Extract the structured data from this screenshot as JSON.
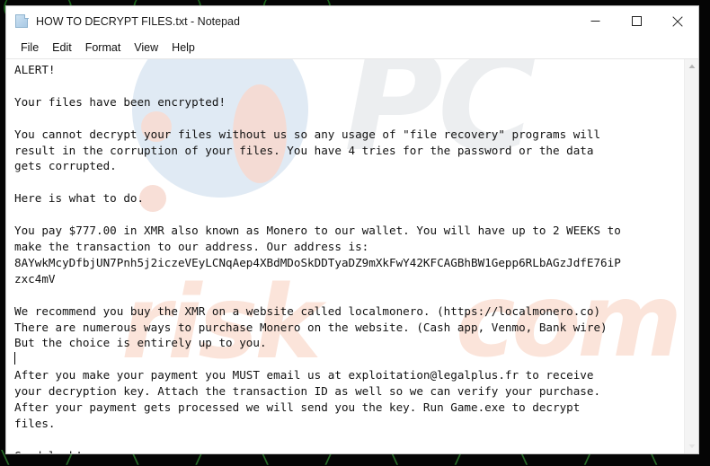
{
  "window": {
    "title": "HOW TO DECRYPT FILES.txt - Notepad",
    "app_icon": "notepad-document-icon",
    "controls": {
      "minimize": "minimize-icon",
      "maximize": "maximize-icon",
      "close": "close-icon"
    }
  },
  "menu": {
    "items": [
      {
        "label": "File"
      },
      {
        "label": "Edit"
      },
      {
        "label": "Format"
      },
      {
        "label": "View"
      },
      {
        "label": "Help"
      }
    ]
  },
  "scrollbar": {
    "up_arrow": "scroll-up-arrow-icon",
    "down_arrow": "scroll-down-arrow-icon"
  },
  "watermark": {
    "brand_mark": "PC",
    "word_left": "risk",
    "word_right": "com",
    "colors": {
      "blue_circle": "#dbe6f2",
      "peach_blob": "#f7dcd3",
      "grey_mark": "#eceef0",
      "peach_text": "#fbe4da"
    }
  },
  "ransom_note": {
    "part_1": "ALERT!\n\nYour files have been encrypted!\n\nYou cannot decrypt your files without us so any usage of \"file recovery\" programs will\nresult in the corruption of your files. You have 4 tries for the password or the data\ngets corrupted.\n\nHere is what to do.\n\nYou pay $777.00 in XMR also known as Monero to our wallet. You will have up to 2 WEEKS to\nmake the transaction to our address. Our address is:\n8AYwkMcyDfbjUN7Pnh5j2iczeVEyLCNqAep4XBdMDoSkDDTyaDZ9mXkFwY42KFCAGBhBW1Gepp6RLbAGzJdfE76iP\nzxc4mV\n\nWe recommend you buy the XMR on a website called localmonero. (https://localmonero.co)\nThere are numerous ways to purchase Monero on the website. (Cash app, Venmo, Bank wire)\nBut the choice is entirely up to you.\n",
    "part_2": "\nAfter you make your payment you MUST email us at exploitation@legalplus.fr to receive\nyour decryption key. Attach the transaction ID as well so we can verify your purchase.\nAfter your payment gets processed we will send you the key. Run Game.exe to decrypt\nfiles.\n\nGood luck!",
    "ransom_amount": "$777.00",
    "currency": "XMR",
    "currency_name": "Monero",
    "deadline": "2 WEEKS",
    "password_tries": "4",
    "wallet_address": "8AYwkMcyDfbjUN7Pnh5j2iczeVEyLCNqAep4XBdMDoSkDDTyaDZ9mXkFwY42KFCAGBhBW1Gepp6RLbAGzJdfE76iPzxc4mV",
    "contact_email": "exploitation@legalplus.fr",
    "exchange_site": "localmonero",
    "exchange_url": "https://localmonero.co",
    "payment_methods": "Cash app, Venmo, Bank wire",
    "decryptor_executable": "Game.exe"
  },
  "desktop": {
    "glyph_row_top": "( ) ( ) ( )",
    "glyph_row_bottom": "\\ / \\ / \\ / \\ / \\ / \\ /    \\ /"
  }
}
